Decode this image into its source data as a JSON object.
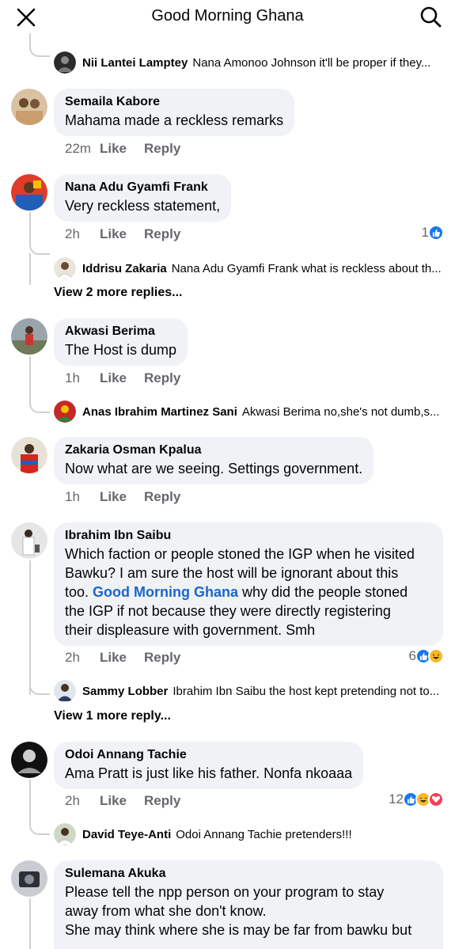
{
  "header": {
    "title": "Good Morning Ghana"
  },
  "comments": [
    {
      "name": "Semaila Kabore",
      "text": "Mahama made a reckless remarks",
      "time": "22m",
      "like": "Like",
      "reply": "Reply"
    },
    {
      "name": "Nana Adu Gyamfi Frank",
      "text": "Very reckless statement,",
      "time": "2h",
      "like": "Like",
      "reply": "Reply",
      "reaction_count": "1"
    },
    {
      "name": "Akwasi Berima",
      "text": "The Host is dump",
      "time": "1h",
      "like": "Like",
      "reply": "Reply"
    },
    {
      "name": "Zakaria Osman Kpalua",
      "text": "Now what are we seeing. Settings government.",
      "time": "1h",
      "like": "Like",
      "reply": "Reply"
    },
    {
      "name": "Ibrahim Ibn Saibu",
      "text_lines": [
        "Which faction or people stoned the IGP when he visited",
        "Bawku? I am sure the host will be ignorant about this",
        "too."
      ],
      "mention": "Good Morning Ghana",
      "text_after_mention": " why did the people stoned",
      "text_lines_end": [
        "the IGP if not because they were directly registering",
        "their displeasure with government. Smh"
      ],
      "time": "2h",
      "like": "Like",
      "reply": "Reply",
      "reaction_count": "6"
    },
    {
      "name": "Odoi Annang Tachie",
      "text": "Ama Pratt is just like his father. Nonfa nkoaaa",
      "time": "2h",
      "like": "Like",
      "reply": "Reply",
      "reaction_count": "12"
    },
    {
      "name": "Sulemana Akuka",
      "text_lines": [
        "Please tell the npp person on your program to stay",
        "away from what she don't know.",
        "She may think where she is may be far from bawku but"
      ]
    }
  ],
  "replies": [
    {
      "name": "Nii Lantei Lamptey",
      "text": "Nana Amonoo Johnson it'll be proper if they..."
    },
    {
      "name": "Iddrisu Zakaria",
      "text": "Nana Adu Gyamfi Frank what is reckless about th..."
    },
    {
      "name": "Anas Ibrahim Martinez Sani",
      "text": "Akwasi Berima no,she's not dumb,s..."
    },
    {
      "name": "Sammy Lobber",
      "text": "Ibrahim Ibn Saibu the host kept pretending not to..."
    },
    {
      "name": "David Teye-Anti",
      "text": "Odoi Annang Tachie pretenders!!!"
    }
  ],
  "view_more": {
    "a": "View 2 more replies...",
    "b": "View 1 more reply..."
  },
  "colors": {
    "link": "#1b66c9",
    "like": "#1877f2",
    "haha": "#f7b928",
    "love": "#f33e58",
    "bubble": "#f0f2f5",
    "meta": "#65676b"
  },
  "icons": {
    "close": "close-icon",
    "search": "search-icon"
  }
}
